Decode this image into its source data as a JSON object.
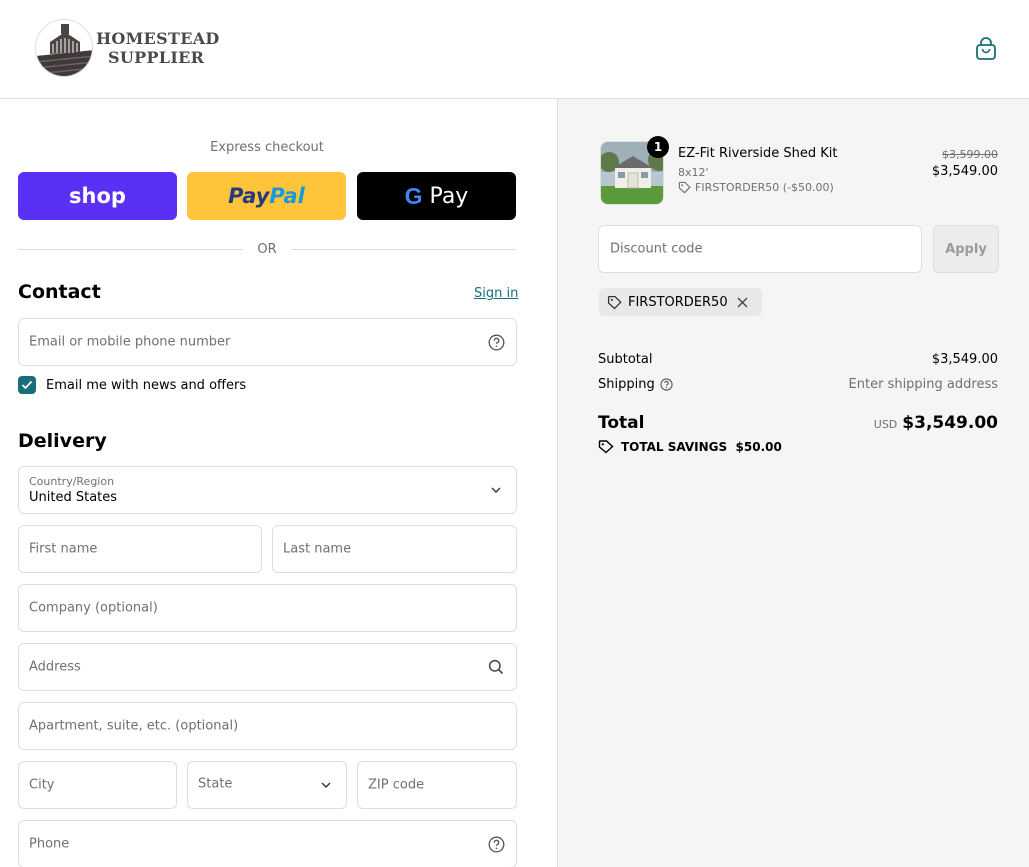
{
  "header": {
    "brand_line1": "HOMESTEAD",
    "brand_line2": "SUPPLIER",
    "cart_icon": "shopping-bag-icon"
  },
  "checkout": {
    "express_title": "Express checkout",
    "shop_pay_label": "shop",
    "paypal_part1": "Pay",
    "paypal_part2": "Pal",
    "gpay_g": "G",
    "gpay_label": "Pay",
    "or_label": "OR"
  },
  "contact": {
    "heading": "Contact",
    "sign_in": "Sign in",
    "email_placeholder": "Email or mobile phone number",
    "news_checkbox_label": "Email me with news and offers",
    "news_checked": true
  },
  "delivery": {
    "heading": "Delivery",
    "country_label": "Country/Region",
    "country_value": "United States",
    "first_name": "First name",
    "last_name": "Last name",
    "company": "Company (optional)",
    "address": "Address",
    "apartment": "Apartment, suite, etc. (optional)",
    "city": "City",
    "state": "State",
    "zip": "ZIP code",
    "phone": "Phone"
  },
  "summary": {
    "product": {
      "quantity": "1",
      "name": "EZ-Fit Riverside Shed Kit",
      "variant": "8x12'",
      "discount_applied": "FIRSTORDER50 (-$50.00)",
      "original_price": "$3,599.00",
      "price": "$3,549.00"
    },
    "discount_placeholder": "Discount code",
    "apply_label": "Apply",
    "applied_code": "FIRSTORDER50",
    "subtotal_label": "Subtotal",
    "subtotal_value": "$3,549.00",
    "shipping_label": "Shipping",
    "shipping_value": "Enter shipping address",
    "total_label": "Total",
    "currency": "USD",
    "total_value": "$3,549.00",
    "savings_label": "TOTAL SAVINGS",
    "savings_value": "$50.00"
  },
  "colors": {
    "accent": "#1a6e7b",
    "shop_pay": "#5a31f4",
    "paypal": "#ffc439",
    "gpay": "#000000",
    "summary_bg": "#f5f5f5"
  }
}
